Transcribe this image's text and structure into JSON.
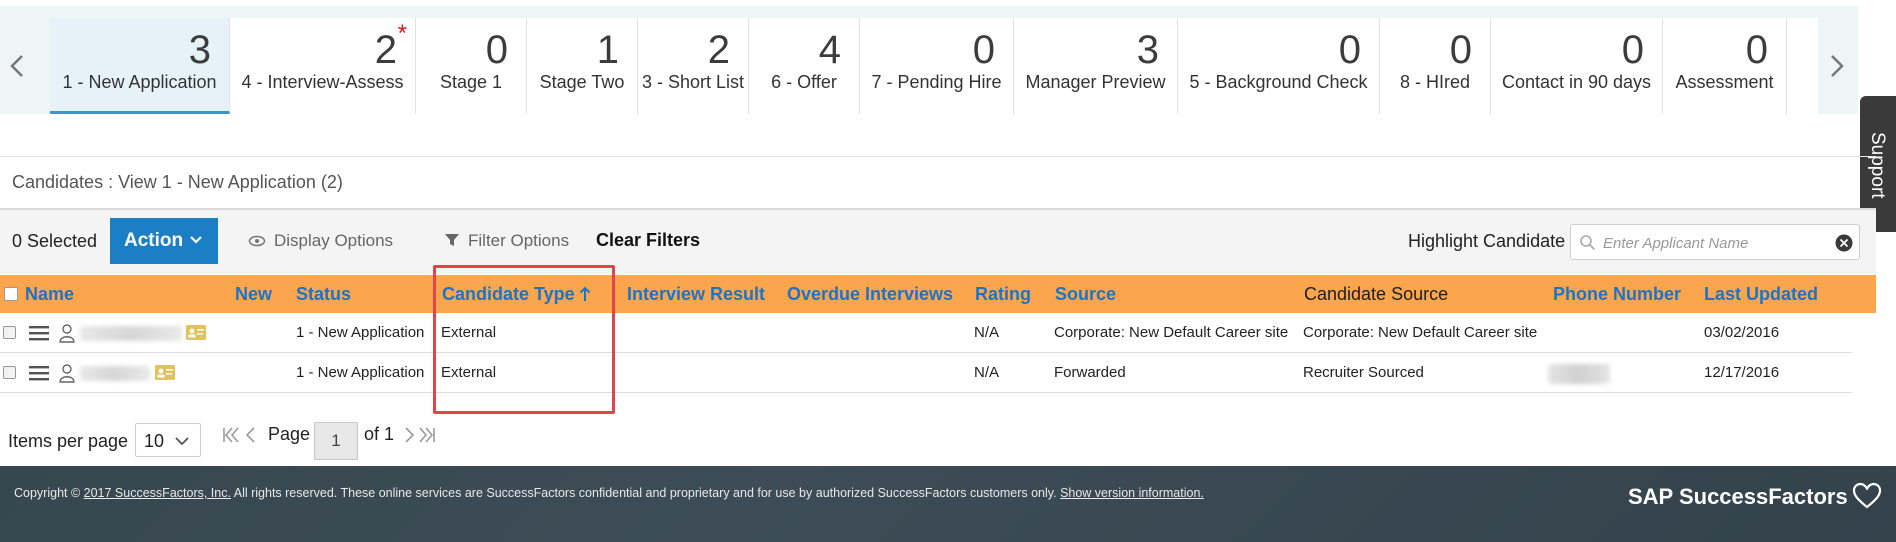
{
  "stages": [
    {
      "count": "3",
      "label": "1 - New Application",
      "active": true,
      "flag": ""
    },
    {
      "count": "2",
      "label": "4 - Interview-Assess",
      "active": false,
      "flag": "*"
    },
    {
      "count": "0",
      "label": "Stage 1",
      "active": false,
      "flag": ""
    },
    {
      "count": "1",
      "label": "Stage Two",
      "active": false,
      "flag": ""
    },
    {
      "count": "2",
      "label": "3 - Short List",
      "active": false,
      "flag": ""
    },
    {
      "count": "4",
      "label": "6 - Offer",
      "active": false,
      "flag": ""
    },
    {
      "count": "0",
      "label": "7 - Pending Hire",
      "active": false,
      "flag": ""
    },
    {
      "count": "3",
      "label": "Manager Preview",
      "active": false,
      "flag": ""
    },
    {
      "count": "0",
      "label": "5 - Background Check",
      "active": false,
      "flag": ""
    },
    {
      "count": "0",
      "label": "8 - HIred",
      "active": false,
      "flag": ""
    },
    {
      "count": "0",
      "label": "Contact in 90 days",
      "active": false,
      "flag": ""
    },
    {
      "count": "0",
      "label": "Assessment",
      "active": false,
      "flag": ""
    }
  ],
  "support_label": "Support",
  "view_title": "Candidates : View 1 - New Application (2)",
  "toolbar": {
    "selected": "0 Selected",
    "action": "Action",
    "display_options": "Display Options",
    "filter_options": "Filter Options",
    "clear_filters": "Clear Filters",
    "highlight_label": "Highlight Candidate",
    "search_placeholder": "Enter Applicant Name"
  },
  "columns": {
    "name": "Name",
    "new": "New",
    "status": "Status",
    "candidate_type": "Candidate Type",
    "interview_result": "Interview Result",
    "overdue_interviews": "Overdue Interviews",
    "rating": "Rating",
    "source": "Source",
    "candidate_source": "Candidate Source",
    "phone": "Phone Number",
    "last_updated": "Last Updated"
  },
  "rows": [
    {
      "status": "1 - New Application",
      "candidate_type": "External",
      "rating": "N/A",
      "source": "Corporate: New Default Career site",
      "candidate_source": "Corporate: New Default Career site",
      "last_updated": "03/02/2016"
    },
    {
      "status": "1 - New Application",
      "candidate_type": "External",
      "rating": "N/A",
      "source": "Forwarded",
      "candidate_source": "Recruiter Sourced",
      "last_updated": "12/17/2016"
    }
  ],
  "pager": {
    "items_label": "Items per page",
    "per_page": "10",
    "page_word": "Page",
    "current_page": "1",
    "of_total": "of 1"
  },
  "footer": {
    "copyright_prefix": "Copyright © ",
    "copyright_link": "2017 SuccessFactors, Inc.",
    "copyright_text": " All rights reserved. These online services are SuccessFactors confidential and proprietary and for use by authorized SuccessFactors customers only. ",
    "version_link": "Show version information.",
    "brand": "SAP SuccessFactors"
  },
  "colors": {
    "header_orange": "#fba54c",
    "accent_blue": "#1a7fc4",
    "column_link_blue": "#1c74c6",
    "highlight_red": "#e0454b",
    "footer_slate": "#37474f"
  }
}
